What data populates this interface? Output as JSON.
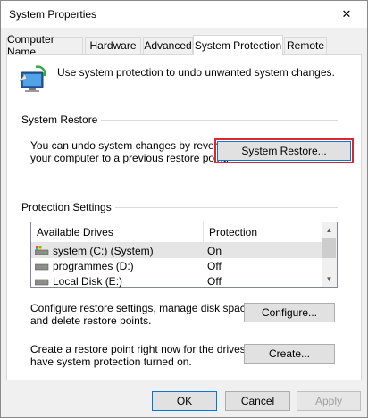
{
  "window": {
    "title": "System Properties",
    "close_glyph": "✕"
  },
  "tabs": [
    {
      "label": "Computer Name"
    },
    {
      "label": "Hardware"
    },
    {
      "label": "Advanced"
    },
    {
      "label": "System Protection"
    },
    {
      "label": "Remote"
    }
  ],
  "active_tab": "System Protection",
  "intro": {
    "text": "Use system protection to undo unwanted system changes."
  },
  "system_restore": {
    "group_label": "System Restore",
    "description_line1": "You can undo system changes by reverting",
    "description_line2": "your computer to a previous restore point.",
    "button_label": "System Restore..."
  },
  "protection_settings": {
    "group_label": "Protection Settings",
    "columns": [
      "Available Drives",
      "Protection"
    ],
    "drives": [
      {
        "name": "system (C:) (System)",
        "protection": "On",
        "selected": true
      },
      {
        "name": "programmes (D:)",
        "protection": "Off",
        "selected": false
      },
      {
        "name": "Local Disk (E:)",
        "protection": "Off",
        "selected": false
      }
    ],
    "configure_text_line1": "Configure restore settings, manage disk space,",
    "configure_text_line2": "and delete restore points.",
    "configure_button": "Configure...",
    "create_text_line1": "Create a restore point right now for the drives that",
    "create_text_line2": "have system protection turned on.",
    "create_button": "Create..."
  },
  "footer": {
    "ok": "OK",
    "cancel": "Cancel",
    "apply": "Apply"
  },
  "colors": {
    "highlight_outline": "#e0262c",
    "selected_row": "#e5e5e5",
    "accent": "#0078d7"
  }
}
